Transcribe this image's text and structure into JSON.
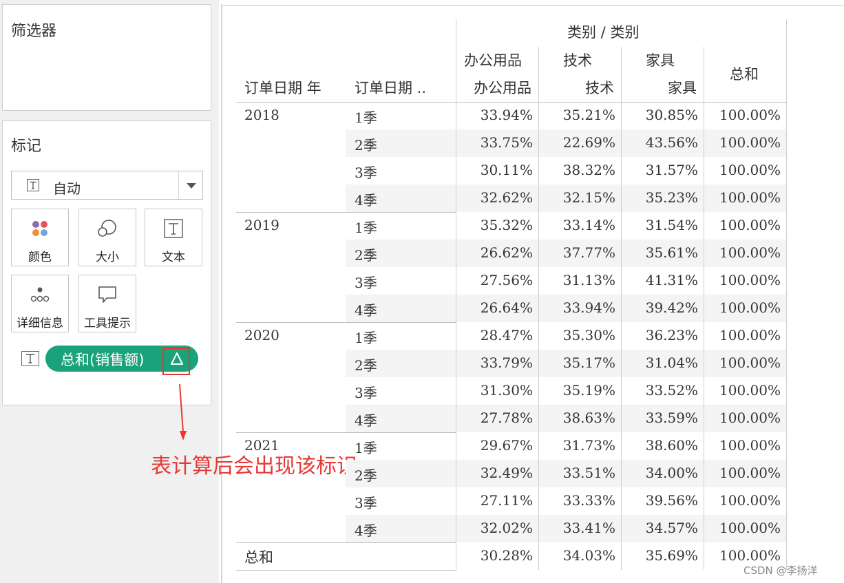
{
  "left": {
    "filters_title": "筛选器",
    "marks_title": "标记",
    "mark_type": "自动",
    "cards": [
      {
        "label": "颜色",
        "icon": "color-dots-icon"
      },
      {
        "label": "大小",
        "icon": "size-circles-icon"
      },
      {
        "label": "文本",
        "icon": "text-t-icon"
      },
      {
        "label": "详细信息",
        "icon": "detail-dots-icon"
      },
      {
        "label": "工具提示",
        "icon": "tooltip-bubble-icon"
      }
    ],
    "pill_label": "总和(销售额)",
    "pill_delta": "△",
    "colors": {
      "pill": "#1aa37a",
      "highlight": "#e53935"
    }
  },
  "annotation": "表计算后会出现该标识",
  "watermark": "CSDN @李扬洋",
  "table": {
    "header_group": "类别  /  类别",
    "row_headers": [
      "订单日期 年",
      "订单日期 .."
    ],
    "col_top": [
      "办公用品",
      "技术",
      "家具"
    ],
    "col_bottom": [
      "办公用品",
      "技术",
      "家具"
    ],
    "total_header": "总和",
    "years": [
      {
        "year": "2018",
        "rows": [
          {
            "q": "1季",
            "v": [
              "33.94%",
              "35.21%",
              "30.85%",
              "100.00%"
            ]
          },
          {
            "q": "2季",
            "v": [
              "33.75%",
              "22.69%",
              "43.56%",
              "100.00%"
            ]
          },
          {
            "q": "3季",
            "v": [
              "30.11%",
              "38.32%",
              "31.57%",
              "100.00%"
            ]
          },
          {
            "q": "4季",
            "v": [
              "32.62%",
              "32.15%",
              "35.23%",
              "100.00%"
            ]
          }
        ]
      },
      {
        "year": "2019",
        "rows": [
          {
            "q": "1季",
            "v": [
              "35.32%",
              "33.14%",
              "31.54%",
              "100.00%"
            ]
          },
          {
            "q": "2季",
            "v": [
              "26.62%",
              "37.77%",
              "35.61%",
              "100.00%"
            ]
          },
          {
            "q": "3季",
            "v": [
              "27.56%",
              "31.13%",
              "41.31%",
              "100.00%"
            ]
          },
          {
            "q": "4季",
            "v": [
              "26.64%",
              "33.94%",
              "39.42%",
              "100.00%"
            ]
          }
        ]
      },
      {
        "year": "2020",
        "rows": [
          {
            "q": "1季",
            "v": [
              "28.47%",
              "35.30%",
              "36.23%",
              "100.00%"
            ]
          },
          {
            "q": "2季",
            "v": [
              "33.79%",
              "35.17%",
              "31.04%",
              "100.00%"
            ]
          },
          {
            "q": "3季",
            "v": [
              "31.30%",
              "35.19%",
              "33.52%",
              "100.00%"
            ]
          },
          {
            "q": "4季",
            "v": [
              "27.78%",
              "38.63%",
              "33.59%",
              "100.00%"
            ]
          }
        ]
      },
      {
        "year": "2021",
        "rows": [
          {
            "q": "1季",
            "v": [
              "29.67%",
              "31.73%",
              "38.60%",
              "100.00%"
            ]
          },
          {
            "q": "2季",
            "v": [
              "32.49%",
              "33.51%",
              "34.00%",
              "100.00%"
            ]
          },
          {
            "q": "3季",
            "v": [
              "27.11%",
              "33.33%",
              "39.56%",
              "100.00%"
            ]
          },
          {
            "q": "4季",
            "v": [
              "32.02%",
              "33.41%",
              "34.57%",
              "100.00%"
            ]
          }
        ]
      }
    ],
    "total_row": {
      "label": "总和",
      "v": [
        "30.28%",
        "34.03%",
        "35.69%",
        "100.00%"
      ]
    }
  }
}
